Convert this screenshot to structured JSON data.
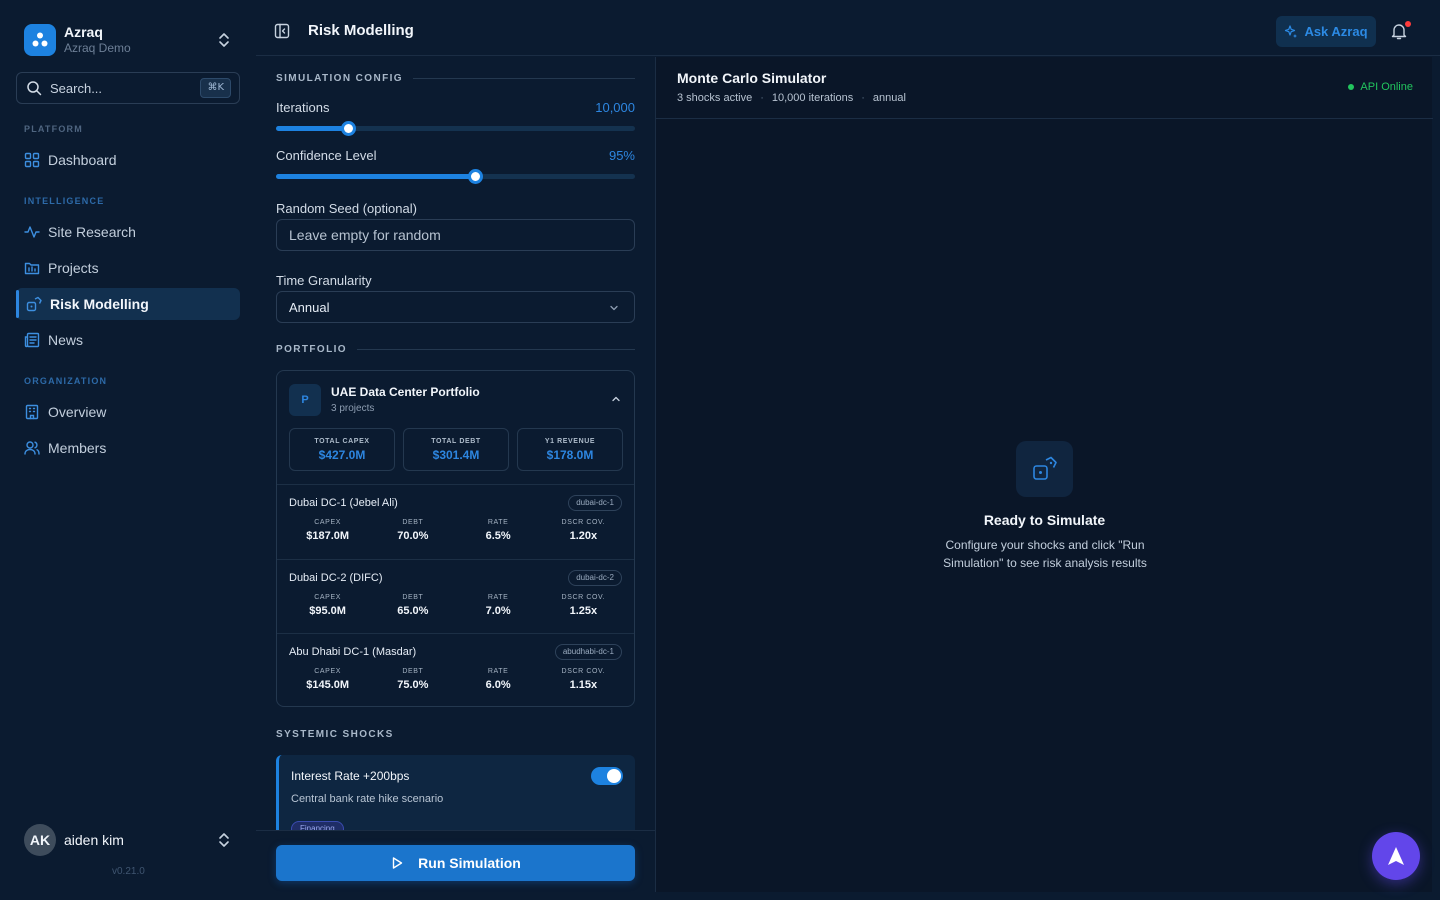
{
  "org": {
    "name": "Azraq",
    "subtitle": "Azraq Demo"
  },
  "search": {
    "placeholder": "Search...",
    "shortcut": "⌘K"
  },
  "nav": {
    "platform_label": "PLATFORM",
    "intelligence_label": "INTELLIGENCE",
    "organization_label": "ORGANIZATION",
    "dashboard": "Dashboard",
    "site_research": "Site Research",
    "projects": "Projects",
    "risk_modelling": "Risk Modelling",
    "news": "News",
    "overview": "Overview",
    "members": "Members"
  },
  "user": {
    "initials": "AK",
    "name": "aiden kim",
    "version": "v0.21.0"
  },
  "header": {
    "title": "Risk Modelling",
    "ask_label": "Ask Azraq"
  },
  "config": {
    "section_title": "SIMULATION CONFIG",
    "iterations_label": "Iterations",
    "iterations_value": "10,000",
    "iterations_fraction": 0.2,
    "confidence_label": "Confidence Level",
    "confidence_value": "95%",
    "confidence_fraction": 0.553,
    "seed_label": "Random Seed (optional)",
    "seed_placeholder": "Leave empty for random",
    "granularity_label": "Time Granularity",
    "granularity_value": "Annual"
  },
  "portfolio": {
    "section_title": "PORTFOLIO",
    "initial": "P",
    "name": "UAE Data Center Portfolio",
    "count": "3 projects",
    "stats": [
      {
        "label": "TOTAL CAPEX",
        "value": "$427.0M"
      },
      {
        "label": "TOTAL DEBT",
        "value": "$301.4M"
      },
      {
        "label": "Y1 REVENUE",
        "value": "$178.0M"
      }
    ],
    "col_labels": [
      "CAPEX",
      "DEBT",
      "RATE",
      "DSCR COV."
    ],
    "projects": [
      {
        "name": "Dubai DC-1 (Jebel Ali)",
        "tag": "dubai-dc-1",
        "capex": "$187.0M",
        "debt": "70.0%",
        "rate": "6.5%",
        "dscr": "1.20x"
      },
      {
        "name": "Dubai DC-2 (DIFC)",
        "tag": "dubai-dc-2",
        "capex": "$95.0M",
        "debt": "65.0%",
        "rate": "7.0%",
        "dscr": "1.25x"
      },
      {
        "name": "Abu Dhabi DC-1 (Masdar)",
        "tag": "abudhabi-dc-1",
        "capex": "$145.0M",
        "debt": "75.0%",
        "rate": "6.0%",
        "dscr": "1.15x"
      }
    ]
  },
  "shocks": {
    "section_title": "SYSTEMIC SHOCKS",
    "items": [
      {
        "title": "Interest Rate +200bps",
        "description": "Central bank rate hike scenario",
        "chip": "Financing",
        "enabled": true
      }
    ]
  },
  "run_label": "Run Simulation",
  "simulator": {
    "title": "Monte Carlo Simulator",
    "meta": [
      "3 shocks active",
      "10,000 iterations",
      "annual"
    ],
    "status": "API Online",
    "empty_title": "Ready to Simulate",
    "empty_desc": "Configure your shocks and click \"Run Simulation\" to see risk analysis results"
  },
  "colors": {
    "accent": "#1d82e0",
    "online": "#22c55e",
    "fab": "#6246ea",
    "background": "#0b1b30"
  },
  "icons": {
    "org_logo": "azraq-logo-icon",
    "search": "search-icon",
    "dashboard": "grid-icon",
    "site_research": "activity-icon",
    "projects": "folder-chart-icon",
    "risk": "dice-icon",
    "news": "newspaper-icon",
    "overview": "building-icon",
    "members": "users-icon",
    "bell": "bell-icon",
    "ask": "sparkles-icon",
    "fab": "navigation-arrow-icon"
  }
}
